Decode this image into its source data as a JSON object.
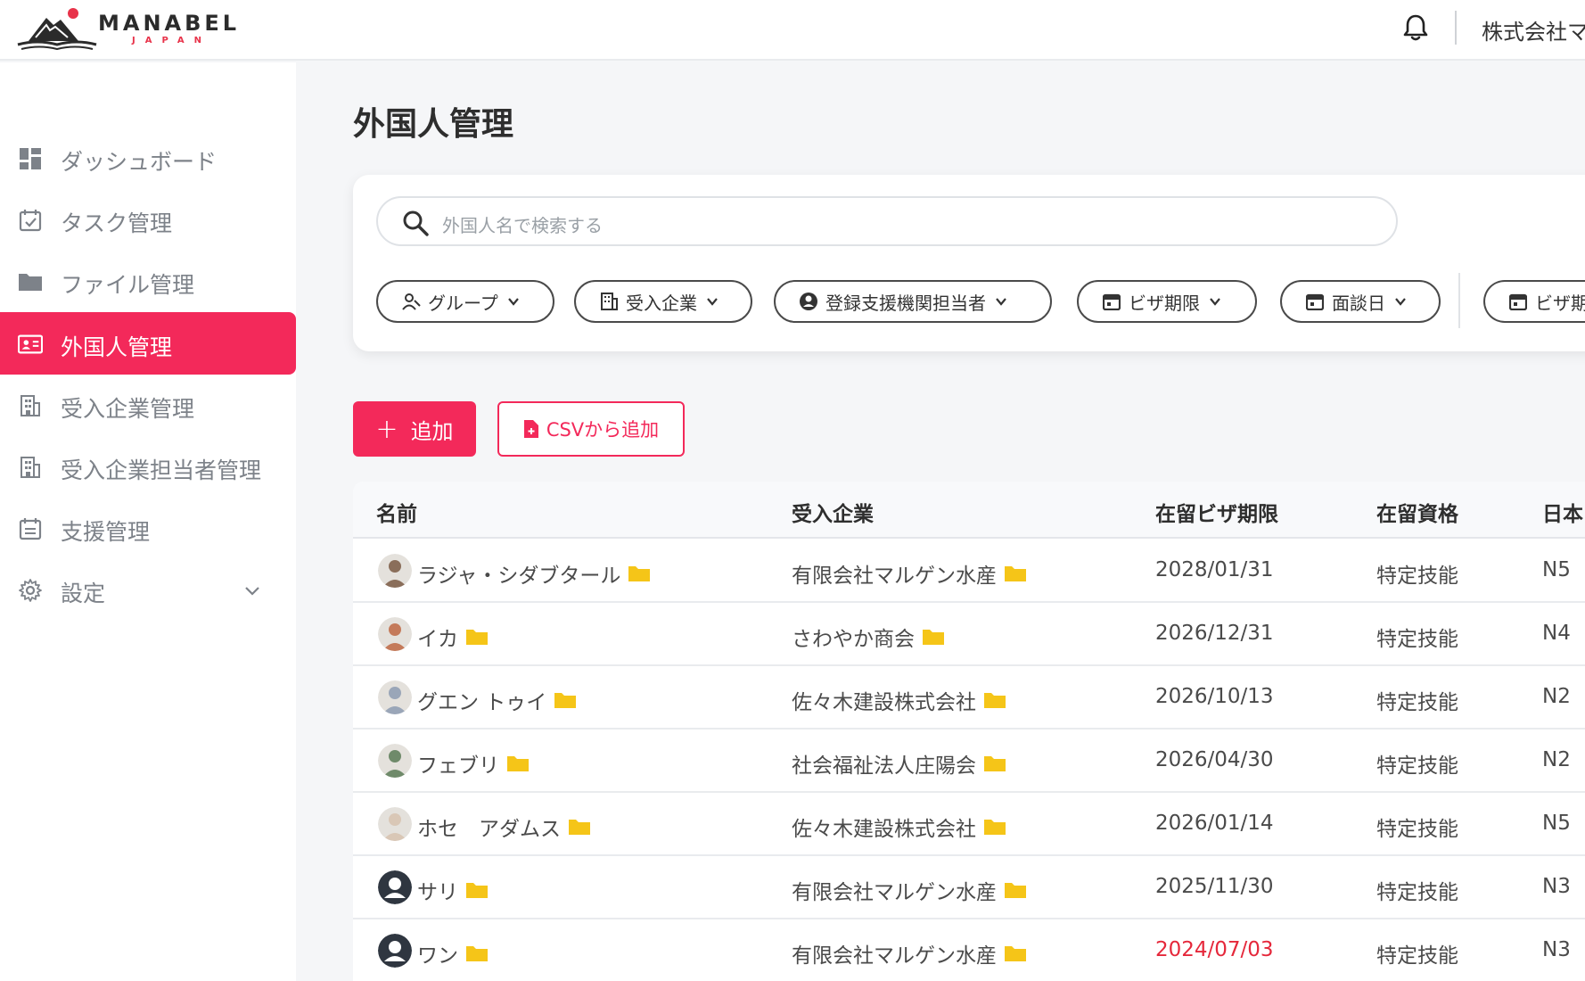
{
  "brand": {
    "name": "MANABEL",
    "sub": "JAPAN",
    "accent": "#f3295a"
  },
  "header": {
    "company": "株式会社マ"
  },
  "sidebar": {
    "items": [
      {
        "label": "ダッシュボード",
        "icon": "dashboard-icon"
      },
      {
        "label": "タスク管理",
        "icon": "calendar-check-icon"
      },
      {
        "label": "ファイル管理",
        "icon": "folder-icon"
      },
      {
        "label": "外国人管理",
        "icon": "id-card-icon",
        "active": true
      },
      {
        "label": "受入企業管理",
        "icon": "building-icon"
      },
      {
        "label": "受入企業担当者管理",
        "icon": "building-icon"
      },
      {
        "label": "支援管理",
        "icon": "calendar-list-icon"
      },
      {
        "label": "設定",
        "icon": "gear-icon"
      }
    ]
  },
  "main": {
    "title": "外国人管理",
    "search": {
      "placeholder": "外国人名で検索する"
    },
    "filters": [
      {
        "label": "グループ",
        "icon": "group-icon"
      },
      {
        "label": "受入企業",
        "icon": "building-icon"
      },
      {
        "label": "登録支援機関担当者",
        "icon": "user-circle-icon"
      },
      {
        "label": "ビザ期限",
        "icon": "calendar-icon"
      },
      {
        "label": "面談日",
        "icon": "calendar-icon"
      },
      {
        "label": "ビザ期",
        "icon": "calendar-icon"
      }
    ],
    "actions": {
      "add_label": "追加",
      "add_plus": "+",
      "csv_label": "CSVから追加"
    }
  },
  "table": {
    "columns": [
      "名前",
      "受入企業",
      "在留ビザ期限",
      "在留資格",
      "日本"
    ],
    "rows": [
      {
        "name": "ラジャ・シダブタール",
        "company": "有限会社マルゲン水産",
        "visa_expiry": "2028/01/31",
        "status": "特定技能",
        "jp": "N5",
        "expired": false,
        "avatar": "photo"
      },
      {
        "name": "イカ",
        "company": "さわやか商会",
        "visa_expiry": "2026/12/31",
        "status": "特定技能",
        "jp": "N4",
        "expired": false,
        "avatar": "photo"
      },
      {
        "name": "グエン トゥイ",
        "company": "佐々木建設株式会社",
        "visa_expiry": "2026/10/13",
        "status": "特定技能",
        "jp": "N2",
        "expired": false,
        "avatar": "photo"
      },
      {
        "name": "フェブリ",
        "company": "社会福祉法人庄陽会",
        "visa_expiry": "2026/04/30",
        "status": "特定技能",
        "jp": "N2",
        "expired": false,
        "avatar": "photo"
      },
      {
        "name": "ホセ　アダムス",
        "company": "佐々木建設株式会社",
        "visa_expiry": "2026/01/14",
        "status": "特定技能",
        "jp": "N5",
        "expired": false,
        "avatar": "photo"
      },
      {
        "name": "サリ",
        "company": "有限会社マルゲン水産",
        "visa_expiry": "2025/11/30",
        "status": "特定技能",
        "jp": "N3",
        "expired": false,
        "avatar": "default"
      },
      {
        "name": "ワン",
        "company": "有限会社マルゲン水産",
        "visa_expiry": "2024/07/03",
        "status": "特定技能",
        "jp": "N3",
        "expired": true,
        "avatar": "default"
      }
    ]
  },
  "colors": {
    "expired": "#e5283b",
    "folder": "#f5c518",
    "active_nav": "#f3295a"
  }
}
